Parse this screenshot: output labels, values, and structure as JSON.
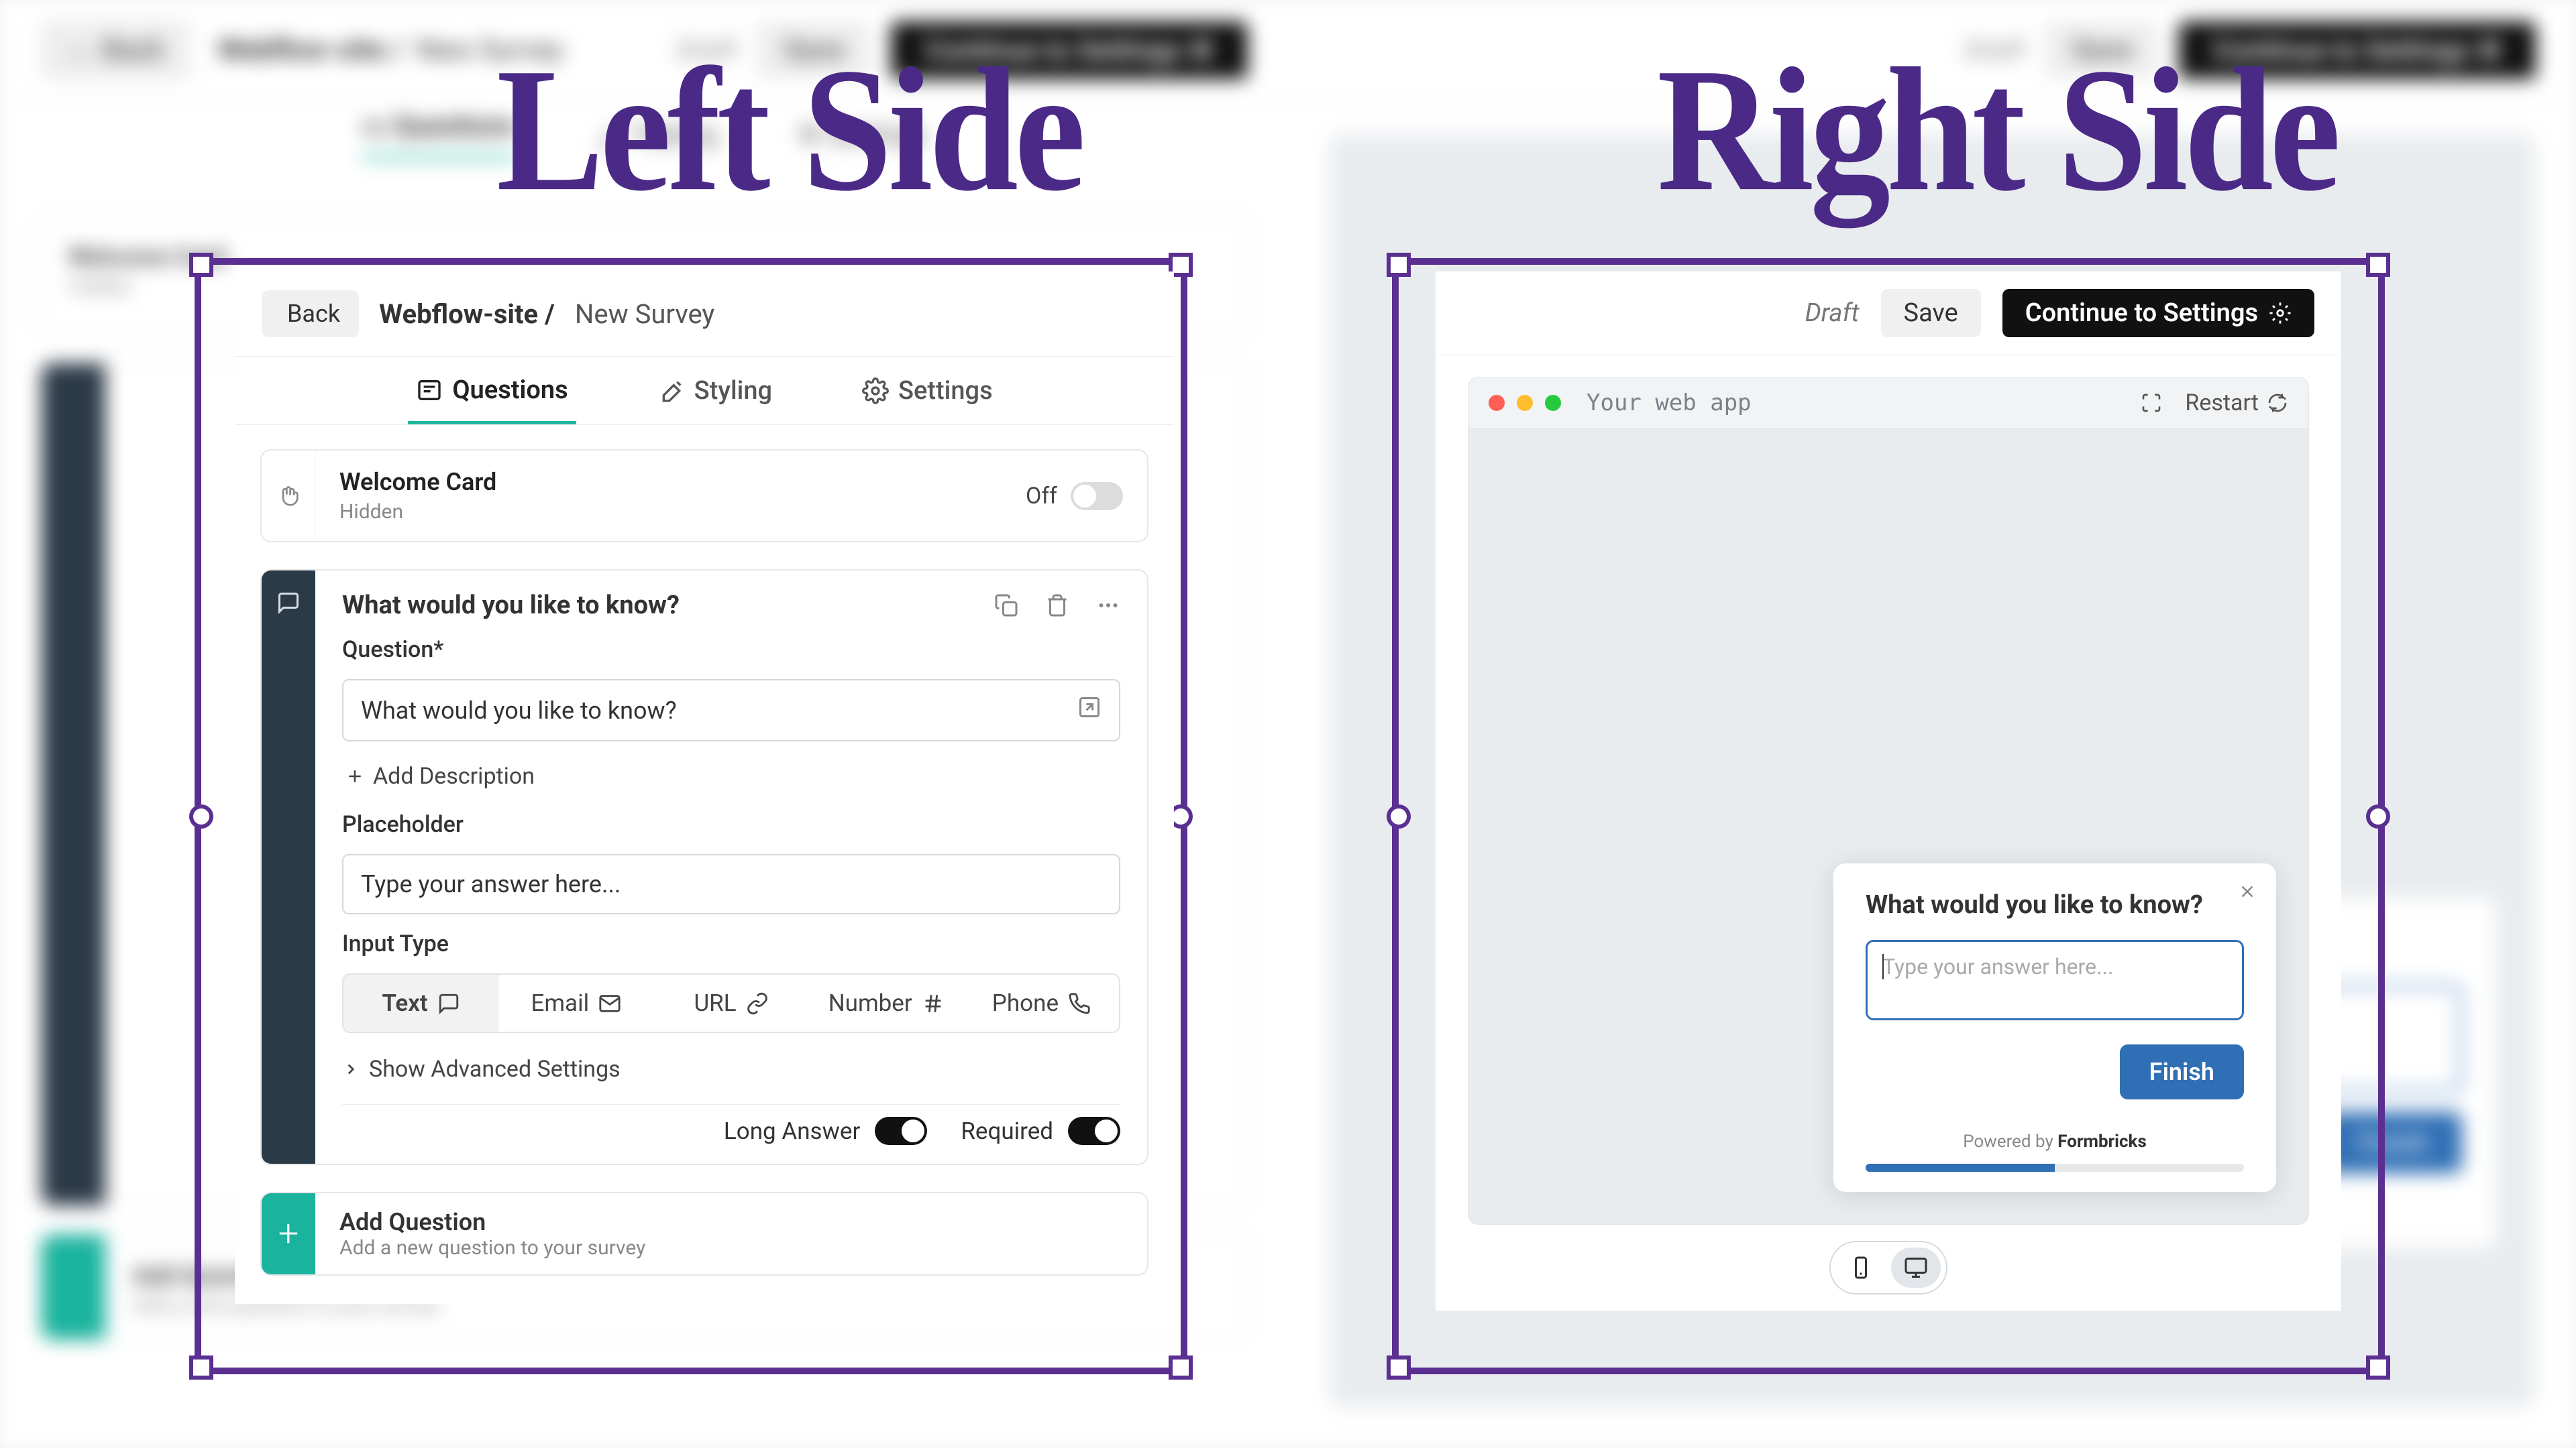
{
  "annotations": {
    "left": "Left Side",
    "right": "Right Side"
  },
  "header": {
    "back": "Back",
    "breadcrumb": "Webflow-site /",
    "title": "New Survey",
    "draft": "Draft",
    "save": "Save",
    "continue": "Continue to Settings"
  },
  "tabs": {
    "questions": "Questions",
    "styling": "Styling",
    "settings": "Settings"
  },
  "welcome": {
    "title": "Welcome Card",
    "status": "Hidden",
    "toggle_label": "Off"
  },
  "question": {
    "heading": "What would you like to know?",
    "label_question": "Question*",
    "value": "What would you like to know?",
    "add_description": "Add Description",
    "label_placeholder": "Placeholder",
    "placeholder_value": "Type your answer here...",
    "label_input_type": "Input Type",
    "types": {
      "text": "Text",
      "email": "Email",
      "url": "URL",
      "number": "Number",
      "phone": "Phone"
    },
    "advanced": "Show Advanced Settings",
    "long_answer": "Long Answer",
    "required": "Required"
  },
  "add_question": {
    "title": "Add Question",
    "sub": "Add a new question to your survey"
  },
  "preview": {
    "app_title": "Your web app",
    "restart": "Restart",
    "popup_question": "What would you like to know?",
    "popup_placeholder": "Type your answer here...",
    "finish": "Finish",
    "powered_prefix": "Powered by ",
    "powered_brand": "Formbricks"
  }
}
